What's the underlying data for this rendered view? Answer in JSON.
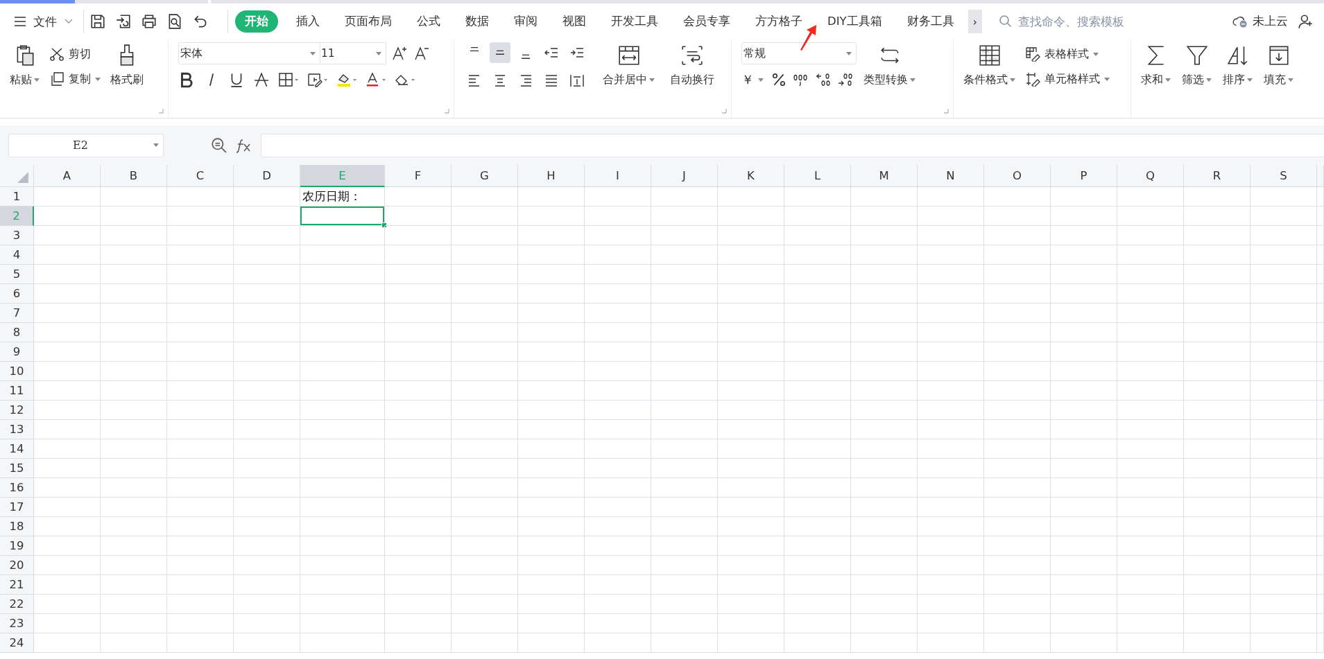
{
  "menu_bar": {
    "file_menu": "文件",
    "tabs": [
      {
        "label": "开始",
        "selected": true
      },
      {
        "label": "插入",
        "selected": false
      },
      {
        "label": "页面布局",
        "selected": false
      },
      {
        "label": "公式",
        "selected": false
      },
      {
        "label": "数据",
        "selected": false
      },
      {
        "label": "审阅",
        "selected": false
      },
      {
        "label": "视图",
        "selected": false
      },
      {
        "label": "开发工具",
        "selected": false
      },
      {
        "label": "会员专享",
        "selected": false
      },
      {
        "label": "方方格子",
        "selected": false
      },
      {
        "label": "DIY工具箱",
        "selected": false
      },
      {
        "label": "财务工具",
        "selected": false
      }
    ],
    "more_tabs": "›",
    "search": {
      "placeholder": "查找命令、搜索模板"
    },
    "cloud_status": "未上云"
  },
  "ribbon": {
    "clipboard": {
      "paste": "粘贴",
      "cut": "剪切",
      "copy": "复制",
      "format_painter": "格式刷"
    },
    "font": {
      "font_name": "宋体",
      "font_size": "11"
    },
    "alignment": {
      "vertical": [
        {
          "kind": "top",
          "selected": false
        },
        {
          "kind": "middle",
          "selected": true
        },
        {
          "kind": "bottom",
          "selected": false
        }
      ],
      "merge_center": "合并居中",
      "wrap_text": "自动换行"
    },
    "number": {
      "format": "常规",
      "currency": "￥",
      "convert": "类型转换"
    },
    "styles": {
      "conditional_format": "条件格式",
      "table_style": "表格样式",
      "cell_style": "单元格样式"
    },
    "editing": {
      "sum": "求和",
      "filter": "筛选",
      "sort": "排序",
      "fill": "填充"
    }
  },
  "formula_bar": {
    "name_box": "E2"
  },
  "sheet": {
    "columns": [
      {
        "label": "A",
        "selected": false
      },
      {
        "label": "B",
        "selected": false
      },
      {
        "label": "C",
        "selected": false
      },
      {
        "label": "D",
        "selected": false
      },
      {
        "label": "E",
        "selected": true
      },
      {
        "label": "F",
        "selected": false
      },
      {
        "label": "G",
        "selected": false
      },
      {
        "label": "H",
        "selected": false
      },
      {
        "label": "I",
        "selected": false
      },
      {
        "label": "J",
        "selected": false
      },
      {
        "label": "K",
        "selected": false
      },
      {
        "label": "L",
        "selected": false
      },
      {
        "label": "M",
        "selected": false
      },
      {
        "label": "N",
        "selected": false
      },
      {
        "label": "O",
        "selected": false
      },
      {
        "label": "P",
        "selected": false
      },
      {
        "label": "Q",
        "selected": false
      },
      {
        "label": "R",
        "selected": false
      },
      {
        "label": "S",
        "selected": false
      }
    ],
    "rows": [
      {
        "label": "1",
        "selected": false,
        "cells": [
          null,
          null,
          null,
          null,
          "农历日期："
        ]
      },
      {
        "label": "2",
        "selected": true
      },
      {
        "label": "3",
        "selected": false
      },
      {
        "label": "4",
        "selected": false
      },
      {
        "label": "5",
        "selected": false
      },
      {
        "label": "6",
        "selected": false
      },
      {
        "label": "7",
        "selected": false
      },
      {
        "label": "8",
        "selected": false
      },
      {
        "label": "9",
        "selected": false
      },
      {
        "label": "10",
        "selected": false
      },
      {
        "label": "11",
        "selected": false
      },
      {
        "label": "12",
        "selected": false
      },
      {
        "label": "13",
        "selected": false
      },
      {
        "label": "14",
        "selected": false
      },
      {
        "label": "15",
        "selected": false
      },
      {
        "label": "16",
        "selected": false
      },
      {
        "label": "17",
        "selected": false
      },
      {
        "label": "18",
        "selected": false
      },
      {
        "label": "19",
        "selected": false
      },
      {
        "label": "20",
        "selected": false
      },
      {
        "label": "21",
        "selected": false
      },
      {
        "label": "22",
        "selected": false
      },
      {
        "label": "23",
        "selected": false
      },
      {
        "label": "24",
        "selected": false
      }
    ]
  }
}
